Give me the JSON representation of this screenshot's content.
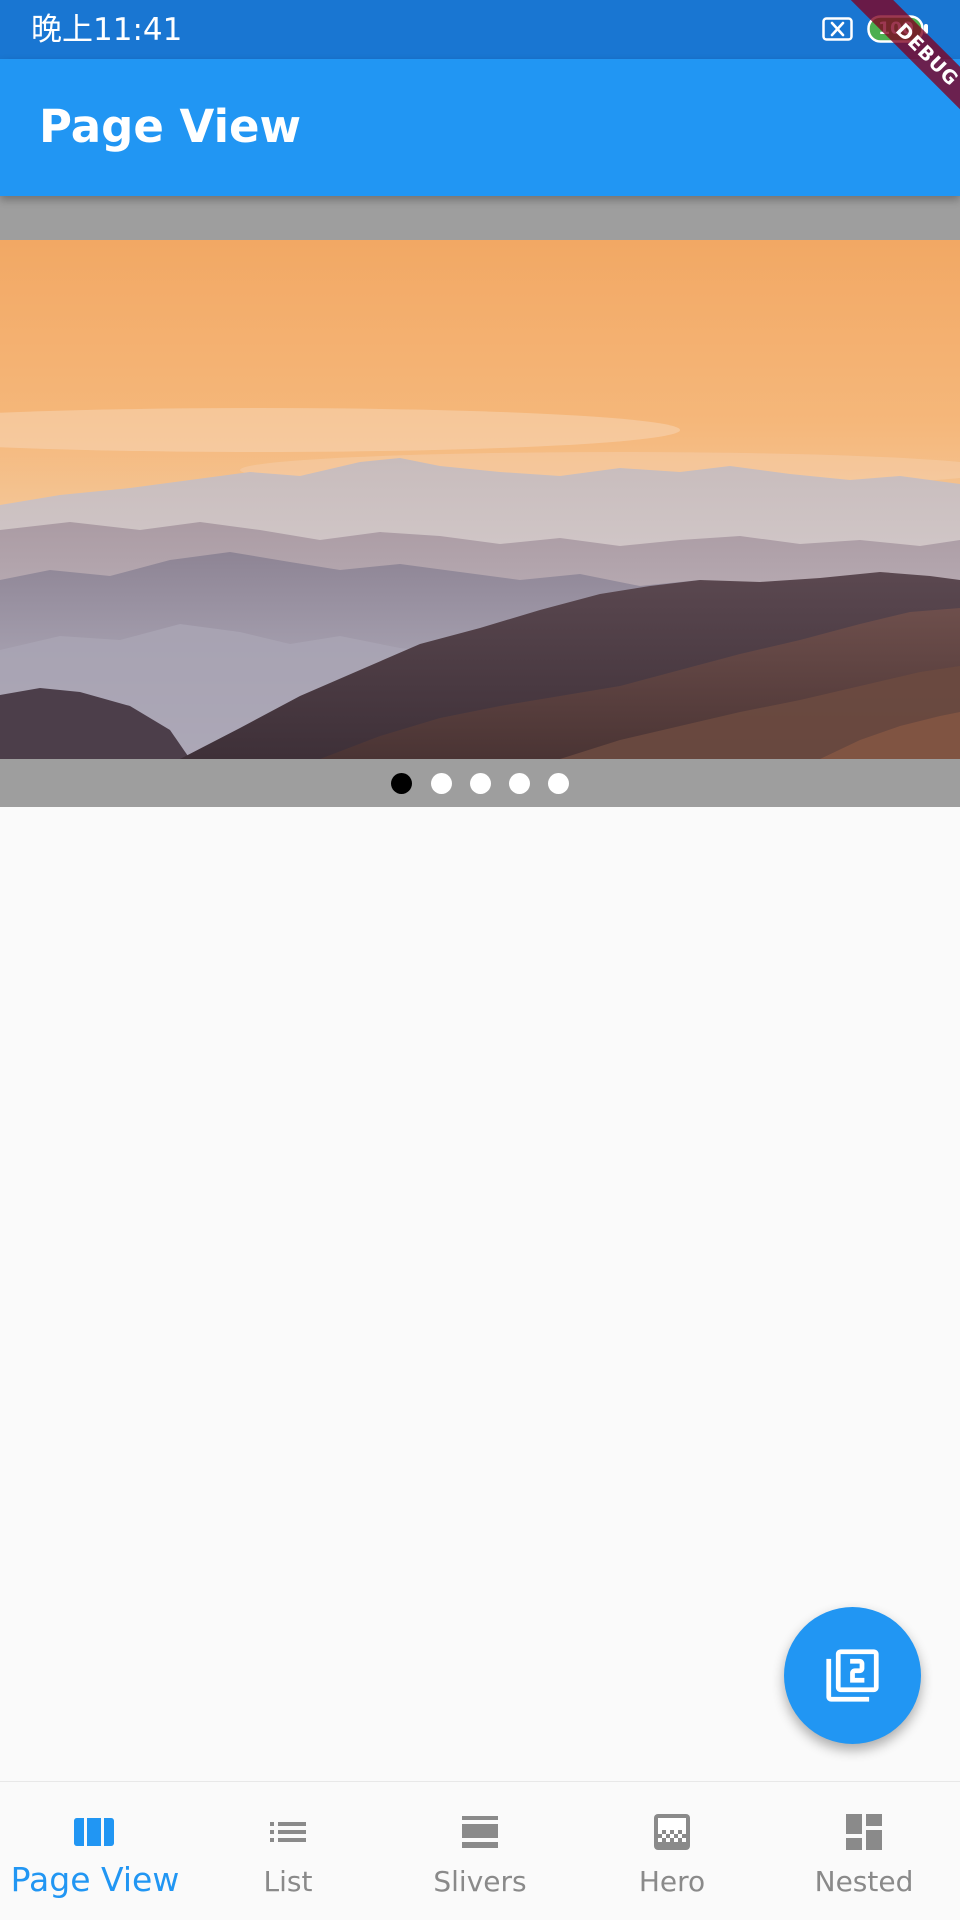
{
  "status_bar": {
    "time": "晚上11:41",
    "battery": "100",
    "sim_icon": "sim-off-icon",
    "battery_icon": "battery-icon"
  },
  "debug_banner": "DEBUG",
  "app_bar": {
    "title": "Page View"
  },
  "page_view": {
    "image": "mountain-sunset-landscape",
    "page_count": 5,
    "current_page": 1
  },
  "fab": {
    "icon": "filter-2-icon"
  },
  "bottom_nav": {
    "items": [
      {
        "label": "Page View",
        "icon": "view-column-icon",
        "active": true
      },
      {
        "label": "List",
        "icon": "list-icon",
        "active": false
      },
      {
        "label": "Slivers",
        "icon": "view-stream-icon",
        "active": false
      },
      {
        "label": "Hero",
        "icon": "hero-image-icon",
        "active": false
      },
      {
        "label": "Nested",
        "icon": "dashboard-icon",
        "active": false
      }
    ]
  },
  "colors": {
    "primary": "#2196f3",
    "status_bar": "#1976d2",
    "inactive": "#8a8a8a",
    "page_background": "#9e9e9e"
  }
}
